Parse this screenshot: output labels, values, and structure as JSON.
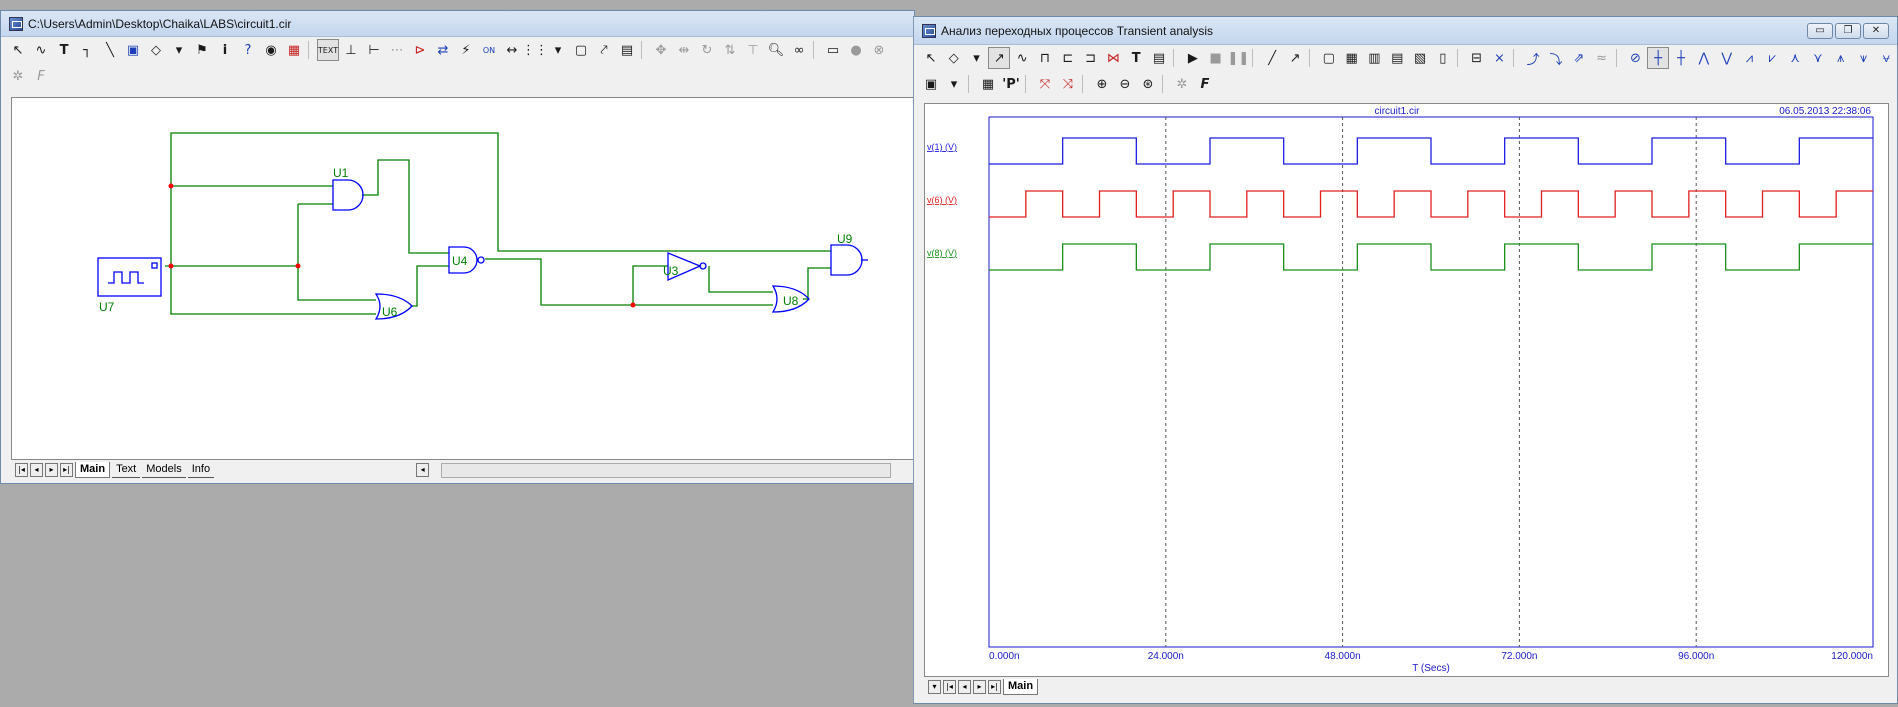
{
  "schematic_window": {
    "title": "C:\\Users\\Admin\\Desktop\\Chaika\\LABS\\circuit1.cir",
    "labels": {
      "u1": "U1",
      "u3": "U3",
      "u4": "U4",
      "u6": "U6",
      "u7": "U7",
      "u8": "U8",
      "u9": "U9"
    },
    "tabs": [
      "Main",
      "Text",
      "Models",
      "Info"
    ],
    "toolbar_icon_names": [
      "select-arrow-icon",
      "wire-icon",
      "text-icon",
      "orthogonal-wire-icon",
      "diagonal-wire-icon",
      "component-icon",
      "flag-icon",
      "info-icon",
      "help-icon",
      "find-icon"
    ]
  },
  "analysis_window": {
    "title": "Анализ переходных процессов Transient analysis",
    "window_buttons": [
      "▭",
      "❐",
      "✕"
    ],
    "tabs": [
      "Main"
    ],
    "plot": {
      "filename": "circuit1.cir",
      "timestamp": "06.05.2013 22:38:06",
      "x_ticks": [
        "0.000n",
        "24.000n",
        "48.000n",
        "72.000n",
        "96.000n",
        "120.000n"
      ],
      "xlabel": "T (Secs)"
    }
  },
  "chart_data": {
    "type": "line",
    "title": "",
    "xlabel": "T (Secs)",
    "xlim": [
      0,
      120
    ],
    "x_unit": "ns",
    "grid": "vertical dashed at major ticks",
    "series": [
      {
        "name": "v(1) (V)",
        "color": "#1f1fe0",
        "period_ns": 20,
        "low_first_ns": 10,
        "duty": "50%"
      },
      {
        "name": "v(6) (V)",
        "color": "#e02020",
        "period_ns": 10,
        "low_first_ns": 5,
        "duty": "50%"
      },
      {
        "name": "v(8) (V)",
        "color": "#1a8f1a",
        "period_ns": 20,
        "low_first_ns": 10,
        "duty": "50%"
      }
    ]
  },
  "colors": {
    "wire": "#008000",
    "component": "#0000ff",
    "node": "#ff0000"
  }
}
